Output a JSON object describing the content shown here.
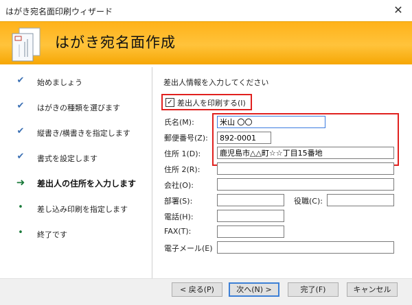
{
  "window": {
    "title": "はがき宛名面印刷ウィザード",
    "close_glyph": "✕"
  },
  "header": {
    "heading": "はがき宛名面作成",
    "icon": "postcard-icon"
  },
  "steps": [
    {
      "label": "始めましょう",
      "state": "done",
      "mark": "✔"
    },
    {
      "label": "はがきの種類を選びます",
      "state": "done",
      "mark": "✔"
    },
    {
      "label": "縦書き/横書きを指定します",
      "state": "done",
      "mark": "✔"
    },
    {
      "label": "書式を設定します",
      "state": "done",
      "mark": "✔"
    },
    {
      "label": "差出人の住所を入力します",
      "state": "current",
      "mark": "➜"
    },
    {
      "label": "差し込み印刷を指定します",
      "state": "pending",
      "mark": "•"
    },
    {
      "label": "終了です",
      "state": "pending",
      "mark": "•"
    }
  ],
  "main": {
    "instruction": "差出人情報を入力してください",
    "print_sender": {
      "label": "差出人を印刷する(I)",
      "checked": true,
      "check_glyph": "✓"
    },
    "fields": {
      "name": {
        "label": "氏名(M):",
        "value": "米山 〇〇"
      },
      "postal": {
        "label": "郵便番号(Z):",
        "value": "892-0001"
      },
      "address1": {
        "label": "住所 1(D):",
        "value": "鹿児島市△△町☆☆丁目15番地"
      },
      "address2": {
        "label": "住所 2(R):",
        "value": ""
      },
      "company": {
        "label": "会社(O):",
        "value": ""
      },
      "department": {
        "label": "部署(S):",
        "value": ""
      },
      "position": {
        "label": "役職(C):",
        "value": ""
      },
      "phone": {
        "label": "電話(H):",
        "value": ""
      },
      "fax": {
        "label": "FAX(T):",
        "value": ""
      },
      "email": {
        "label": "電子メール(E)",
        "value": ""
      }
    }
  },
  "buttons": {
    "back": "< 戻る(P)",
    "next": "次へ(N) >",
    "finish": "完了(F)",
    "cancel": "キャンセル"
  },
  "colors": {
    "accent": "#ffb21a",
    "highlight": "#e0201e",
    "focus": "#3a7be0"
  }
}
